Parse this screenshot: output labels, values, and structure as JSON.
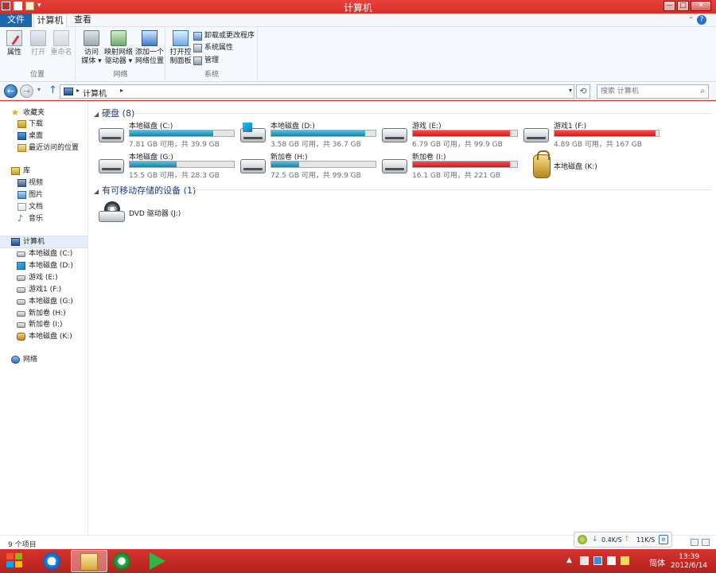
{
  "window": {
    "title": "计算机",
    "quick_access_overflow": "▾",
    "controls": {
      "minimize": "—",
      "maximize": "□",
      "close": "✕"
    }
  },
  "ribbon": {
    "tabs": [
      "文件",
      "计算机",
      "查看"
    ],
    "active_tab": "计算机",
    "groups": [
      {
        "label": "位置",
        "buttons": [
          {
            "label": "属性",
            "icon": "properties-icon",
            "enabled": true
          },
          {
            "label": "打开",
            "icon": "open-icon",
            "enabled": false
          },
          {
            "label": "重命名",
            "icon": "rename-icon",
            "enabled": false
          }
        ]
      },
      {
        "label": "网络",
        "buttons": [
          {
            "label_line1": "访问",
            "label_line2": "媒体",
            "icon": "media-icon",
            "dropdown": true
          },
          {
            "label_line1": "映射网络",
            "label_line2": "驱动器",
            "icon": "map-drive-icon",
            "dropdown": true
          },
          {
            "label_line1": "添加一个",
            "label_line2": "网络位置",
            "icon": "add-network-icon"
          }
        ]
      },
      {
        "label": "系统",
        "buttons": [
          {
            "label_line1": "打开控",
            "label_line2": "制面板",
            "icon": "control-panel-icon"
          }
        ],
        "small_buttons": [
          {
            "label": "卸载或更改程序",
            "icon": "uninstall-icon"
          },
          {
            "label": "系统属性",
            "icon": "system-properties-icon"
          },
          {
            "label": "管理",
            "icon": "manage-icon"
          }
        ]
      }
    ]
  },
  "address_bar": {
    "path": [
      "计算机"
    ],
    "search_placeholder": "搜索 计算机"
  },
  "navigation_pane": {
    "favorites": {
      "label": "收藏夹",
      "items": [
        "下载",
        "桌面",
        "最近访问的位置"
      ]
    },
    "libraries": {
      "label": "库",
      "items": [
        "视频",
        "图片",
        "文档",
        "音乐"
      ]
    },
    "computer": {
      "label": "计算机",
      "items": [
        {
          "label": "本地磁盘 (C:)",
          "icon": "drive-icon"
        },
        {
          "label": "本地磁盘 (D:)",
          "icon": "windows-drive-icon"
        },
        {
          "label": "游戏 (E:)",
          "icon": "drive-icon"
        },
        {
          "label": "游戏1 (F:)",
          "icon": "drive-icon"
        },
        {
          "label": "本地磁盘 (G:)",
          "icon": "drive-icon"
        },
        {
          "label": "新加卷 (H:)",
          "icon": "drive-icon"
        },
        {
          "label": "新加卷 (I:)",
          "icon": "drive-icon"
        },
        {
          "label": "本地磁盘 (K:)",
          "icon": "locked-drive-icon"
        }
      ]
    },
    "network": {
      "label": "网络"
    }
  },
  "content": {
    "hard_disks": {
      "header": "硬盘 (8)",
      "drives": [
        {
          "name": "本地磁盘 (C:)",
          "free": "7.81 GB 可用，共 39.9 GB",
          "used_fraction": 0.8,
          "bar_color": "#17849f",
          "icon": "drive-icon"
        },
        {
          "name": "本地磁盘 (D:)",
          "free": "3.58 GB 可用，共 36.7 GB",
          "used_fraction": 0.9,
          "bar_color": "#17849f",
          "icon": "windows-drive-icon"
        },
        {
          "name": "游戏 (E:)",
          "free": "6.79 GB 可用，共 99.9 GB",
          "used_fraction": 0.93,
          "bar_color": "#d01a1a",
          "icon": "drive-icon"
        },
        {
          "name": "游戏1 (F:)",
          "free": "4.89 GB 可用，共 167 GB",
          "used_fraction": 0.97,
          "bar_color": "#d01a1a",
          "icon": "drive-icon"
        },
        {
          "name": "本地磁盘 (G:)",
          "free": "15.5 GB 可用，共 28.3 GB",
          "used_fraction": 0.45,
          "bar_color": "#17849f",
          "icon": "drive-icon"
        },
        {
          "name": "新加卷 (H:)",
          "free": "72.5 GB 可用，共 99.9 GB",
          "used_fraction": 0.27,
          "bar_color": "#17849f",
          "icon": "drive-icon"
        },
        {
          "name": "新加卷 (I:)",
          "free": "16.1 GB 可用，共 221 GB",
          "used_fraction": 0.93,
          "bar_color": "#d01a1a",
          "icon": "drive-icon"
        },
        {
          "name": "本地磁盘 (K:)",
          "free": "",
          "icon": "locked-drive-icon"
        }
      ]
    },
    "removable": {
      "header": "有可移动存储的设备 (1)",
      "devices": [
        {
          "name": "DVD 驱动器 (J:)",
          "icon": "dvd-drive-icon"
        }
      ]
    }
  },
  "status_bar": {
    "item_count": "9 个项目"
  },
  "net_monitor": {
    "download": "0.4K/S",
    "upload": "11K/S"
  },
  "taskbar": {
    "apps": [
      "ie-icon",
      "explorer-icon",
      "browser-icon",
      "media-player-icon"
    ],
    "active_app": "explorer-icon",
    "ime": "简体",
    "time": "13:39",
    "date": "2012/6/14"
  }
}
